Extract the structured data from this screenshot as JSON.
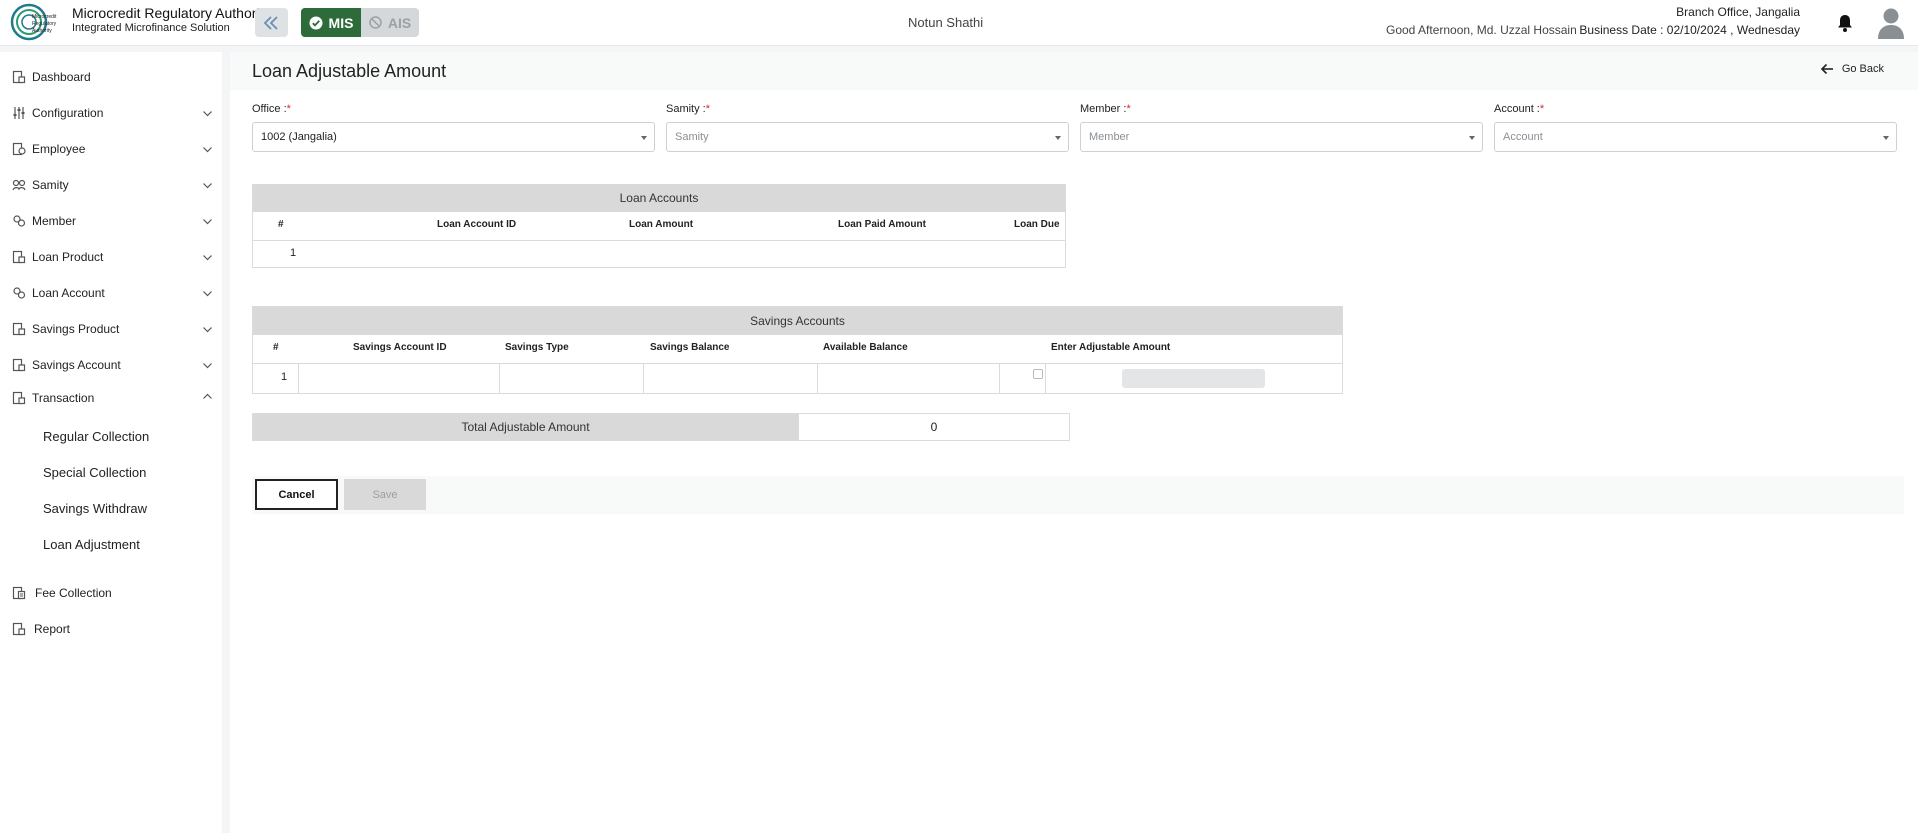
{
  "header": {
    "brand_title": "Microcredit Regulatory Authority",
    "brand_subtitle": "Integrated Microfinance Solution",
    "logo_text": "Microcredit Regulatory Authority",
    "mode_mis": "MIS",
    "mode_ais": "AIS",
    "org_name": "Notun Shathi",
    "greeting": "Good Afternoon, Md. Uzzal Hossain",
    "branch": "Branch Office, Jangalia",
    "business_date": "Business Date : 02/10/2024 , Wednesday",
    "icons": {
      "collapse": "double-chevron-left-icon",
      "notification": "bell-icon",
      "profile": "user-avatar-icon"
    }
  },
  "sidebar": {
    "items": [
      {
        "label": "Dashboard",
        "icon": "dashboard-icon",
        "expandable": false
      },
      {
        "label": "Configuration",
        "icon": "sliders-icon",
        "expandable": true
      },
      {
        "label": "Employee",
        "icon": "employee-icon",
        "expandable": true
      },
      {
        "label": "Samity",
        "icon": "samity-icon",
        "expandable": true
      },
      {
        "label": "Member",
        "icon": "member-icon",
        "expandable": true
      },
      {
        "label": "Loan Product",
        "icon": "loan-product-icon",
        "expandable": true
      },
      {
        "label": "Loan Account",
        "icon": "loan-account-icon",
        "expandable": true
      },
      {
        "label": "Savings Product",
        "icon": "savings-product-icon",
        "expandable": true
      },
      {
        "label": "Savings Account",
        "icon": "savings-account-icon",
        "expandable": true
      },
      {
        "label": "Transaction",
        "icon": "transaction-icon",
        "expandable": true,
        "expanded": true
      },
      {
        "label": "Fee Collection",
        "icon": "fee-collection-icon",
        "expandable": false
      },
      {
        "label": "Report",
        "icon": "report-icon",
        "expandable": false
      }
    ],
    "transaction_sub": [
      "Regular Collection",
      "Special Collection",
      "Savings Withdraw",
      "Loan Adjustment"
    ]
  },
  "page": {
    "title": "Loan Adjustable Amount",
    "go_back": "Go Back"
  },
  "filters": {
    "office": {
      "label": "Office :",
      "value": "1002 (Jangalia)"
    },
    "samity": {
      "label": "Samity :",
      "placeholder": "Samity"
    },
    "member": {
      "label": "Member :",
      "placeholder": "Member"
    },
    "account": {
      "label": "Account :",
      "placeholder": "Account"
    },
    "required_mark": "*"
  },
  "loan_accounts": {
    "caption": "Loan Accounts",
    "columns": [
      "#",
      "Loan Account ID",
      "Loan Amount",
      "Loan Paid Amount",
      "Loan Due"
    ],
    "rows": [
      [
        "1",
        "",
        "",
        "",
        ""
      ]
    ]
  },
  "savings_accounts": {
    "caption": "Savings Accounts",
    "columns": [
      "#",
      "Savings Account ID",
      "Savings Type",
      "Savings Balance",
      "Available Balance",
      "",
      "Enter Adjustable Amount"
    ],
    "rows": [
      [
        "1",
        "",
        "",
        "",
        "",
        "",
        ""
      ]
    ]
  },
  "total": {
    "label": "Total Adjustable Amount",
    "value": "0"
  },
  "actions": {
    "cancel": "Cancel",
    "save": "Save"
  },
  "colors": {
    "mis_active": "#2e6b3a",
    "required": "#e02424",
    "table_header_bg": "#d9d9d9"
  }
}
